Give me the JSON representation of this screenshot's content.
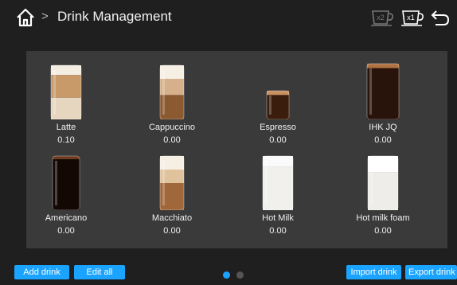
{
  "header": {
    "title": "Drink Management",
    "chevron": ">",
    "cup_x1": "x1",
    "cup_x2": "x2"
  },
  "drinks": [
    {
      "name": "Latte",
      "value": "0.10",
      "style": "latte"
    },
    {
      "name": "Cappuccino",
      "value": "0.00",
      "style": "cappuccino"
    },
    {
      "name": "Espresso",
      "value": "0.00",
      "style": "espresso"
    },
    {
      "name": "IHK JQ",
      "value": "0.00",
      "style": "dark"
    },
    {
      "name": "Americano",
      "value": "0.00",
      "style": "americano"
    },
    {
      "name": "Macchiato",
      "value": "0.00",
      "style": "macchiato"
    },
    {
      "name": "Hot Milk",
      "value": "0.00",
      "style": "milk"
    },
    {
      "name": "Hot milk foam",
      "value": "0.00",
      "style": "milkfoam"
    }
  ],
  "footer": {
    "add_drink": "Add drink",
    "edit_all": "Edit all",
    "import_drink": "Import drink",
    "export_drink": "Export drink",
    "page_count": 2,
    "active_page": 1
  },
  "colors": {
    "accent": "#1aa3ff",
    "background": "#1f1f1f",
    "panel": "#3a3a3a",
    "inactive_dot": "#555555"
  }
}
